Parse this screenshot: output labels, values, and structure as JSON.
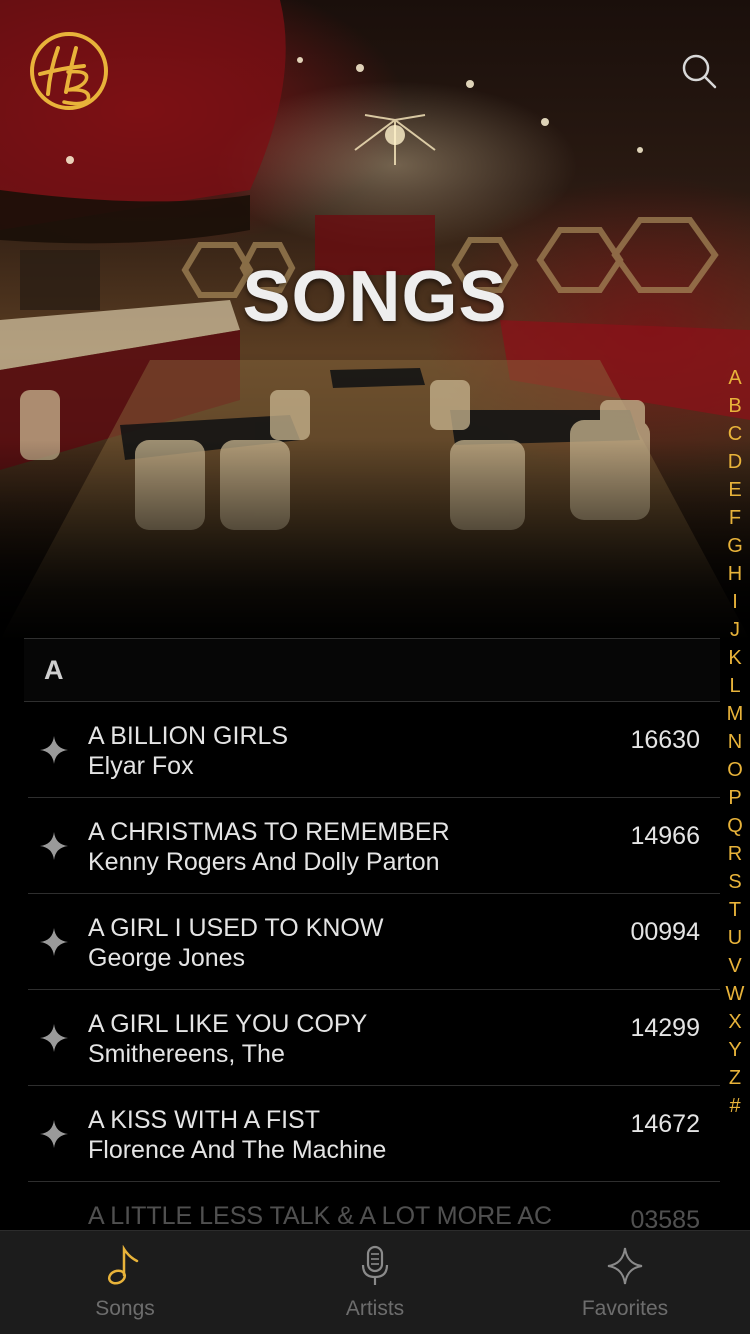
{
  "app": {
    "brand_color": "#E8B33A",
    "logo_letters": "HB"
  },
  "header": {
    "title": "SONGS",
    "search_icon": "search-icon"
  },
  "list": {
    "section_letter": "A",
    "songs": [
      {
        "title": "A BILLION GIRLS",
        "artist": "Elyar Fox",
        "number": "16630"
      },
      {
        "title": "A CHRISTMAS TO REMEMBER",
        "artist": "Kenny Rogers And Dolly Parton",
        "number": "14966"
      },
      {
        "title": "A GIRL I USED TO KNOW",
        "artist": "George Jones",
        "number": "00994"
      },
      {
        "title": "A GIRL LIKE YOU COPY",
        "artist": "Smithereens, The",
        "number": "14299"
      },
      {
        "title": "A KISS WITH A FIST",
        "artist": "Florence And The Machine",
        "number": "14672"
      },
      {
        "title": "A LITTLE LESS TALK & A LOT MORE AC",
        "artist": "",
        "number": "03585"
      }
    ]
  },
  "alphabet": [
    "A",
    "B",
    "C",
    "D",
    "E",
    "F",
    "G",
    "H",
    "I",
    "J",
    "K",
    "L",
    "M",
    "N",
    "O",
    "P",
    "Q",
    "R",
    "S",
    "T",
    "U",
    "V",
    "W",
    "X",
    "Y",
    "Z",
    "#"
  ],
  "tabbar": {
    "tabs": [
      {
        "label": "Songs",
        "icon": "music-note-icon",
        "active": true
      },
      {
        "label": "Artists",
        "icon": "microphone-icon",
        "active": false
      },
      {
        "label": "Favorites",
        "icon": "star-icon",
        "active": false
      }
    ]
  }
}
